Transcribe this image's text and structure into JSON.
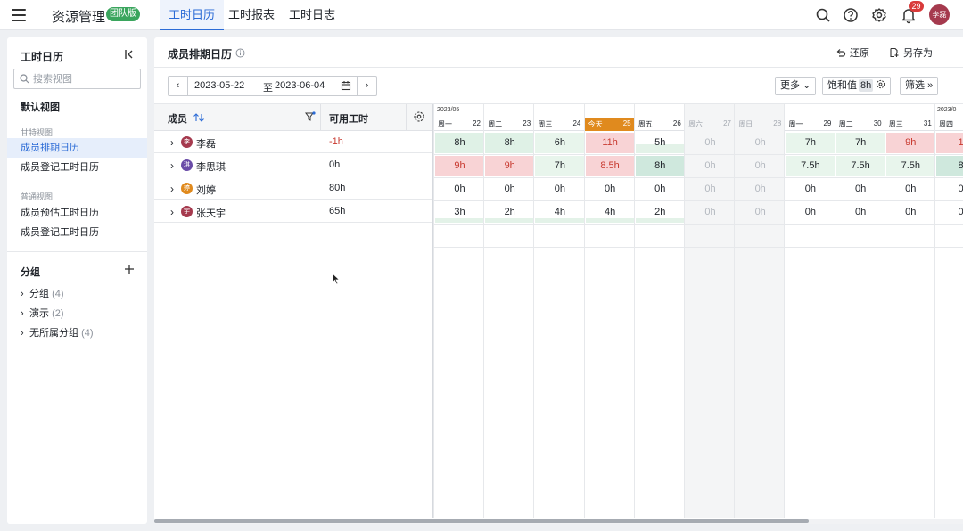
{
  "topbar": {
    "app_title": "资源管理",
    "badge": "团队版",
    "tabs": [
      {
        "label": "工时日历",
        "active": true
      },
      {
        "label": "工时报表",
        "active": false
      },
      {
        "label": "工时日志",
        "active": false
      }
    ],
    "notification_count": "29",
    "user_avatar": "李磊",
    "icons": [
      "menu-icon",
      "search-icon",
      "help-icon",
      "gear-icon",
      "bell-icon"
    ]
  },
  "sidebar": {
    "title": "工时日历",
    "search_placeholder": "搜索视图",
    "default_view": "默认视图",
    "starred_section": "甘特视图",
    "starred_items": [
      "成员排期日历",
      "成员登记工时日历"
    ],
    "normal_section": "普通视图",
    "normal_items": [
      "成员预估工时日历",
      "成员登记工时日历"
    ],
    "group_title": "分组",
    "groups": [
      {
        "label": "分组",
        "count": "(4)"
      },
      {
        "label": "演示",
        "count": "(2)"
      },
      {
        "label": "无所属分组",
        "count": "(4)"
      }
    ]
  },
  "main": {
    "title": "成员排期日历",
    "restore_label": "还原",
    "save_as_label": "另存为",
    "date_start": "2023-05-22",
    "date_sep": "至",
    "date_end": "2023-06-04",
    "more_label": "更多",
    "saturation_label": "饱和值",
    "saturation_value": "8h",
    "filter_label": "筛选"
  },
  "table": {
    "col_member": "成员",
    "col_available": "可用工时",
    "members": [
      {
        "name": "李磊",
        "avatar": "李",
        "avatar_color": "#a53a4e",
        "available": "-1h"
      },
      {
        "name": "李思琪",
        "avatar": "琪",
        "avatar_color": "#6a4ca8",
        "available": "0h"
      },
      {
        "name": "刘婷",
        "avatar": "婷",
        "avatar_color": "#e08a1e",
        "available": "80h"
      },
      {
        "name": "张天宇",
        "avatar": "宇",
        "avatar_color": "#a53a4e",
        "available": "65h"
      }
    ]
  },
  "calendar": {
    "month_labels": [
      "2023/05",
      "2023/0"
    ],
    "days": [
      {
        "wk": "周一",
        "d": "22",
        "type": "work"
      },
      {
        "wk": "周二",
        "d": "23",
        "type": "work"
      },
      {
        "wk": "周三",
        "d": "24",
        "type": "work"
      },
      {
        "wk": "今天",
        "d": "25",
        "type": "today"
      },
      {
        "wk": "周五",
        "d": "26",
        "type": "work"
      },
      {
        "wk": "周六",
        "d": "27",
        "type": "weekend"
      },
      {
        "wk": "周日",
        "d": "28",
        "type": "weekend"
      },
      {
        "wk": "周一",
        "d": "29",
        "type": "work"
      },
      {
        "wk": "周二",
        "d": "30",
        "type": "work"
      },
      {
        "wk": "周三",
        "d": "31",
        "type": "work"
      },
      {
        "wk": "周四",
        "d": "",
        "type": "work"
      }
    ],
    "rows": [
      [
        {
          "v": "8h",
          "s": "green"
        },
        {
          "v": "8h",
          "s": "green"
        },
        {
          "v": "6h",
          "s": "green3"
        },
        {
          "v": "11h",
          "s": "red"
        },
        {
          "v": "5h",
          "s": "bar2"
        },
        {
          "v": "0h",
          "s": "gray"
        },
        {
          "v": "0h",
          "s": "gray"
        },
        {
          "v": "7h",
          "s": "green3"
        },
        {
          "v": "7h",
          "s": "green3"
        },
        {
          "v": "9h",
          "s": "red"
        },
        {
          "v": "1",
          "s": "red"
        }
      ],
      [
        {
          "v": "9h",
          "s": "red"
        },
        {
          "v": "9h",
          "s": "red"
        },
        {
          "v": "7h",
          "s": "green3"
        },
        {
          "v": "8.5h",
          "s": "red"
        },
        {
          "v": "8h",
          "s": "green2"
        },
        {
          "v": "0h",
          "s": "gray"
        },
        {
          "v": "0h",
          "s": "gray"
        },
        {
          "v": "7.5h",
          "s": "green3"
        },
        {
          "v": "7.5h",
          "s": "green3"
        },
        {
          "v": "7.5h",
          "s": "green3"
        },
        {
          "v": "8",
          "s": "green2"
        }
      ],
      [
        {
          "v": "0h",
          "s": ""
        },
        {
          "v": "0h",
          "s": ""
        },
        {
          "v": "0h",
          "s": ""
        },
        {
          "v": "0h",
          "s": ""
        },
        {
          "v": "0h",
          "s": ""
        },
        {
          "v": "0h",
          "s": "gray"
        },
        {
          "v": "0h",
          "s": "gray"
        },
        {
          "v": "0h",
          "s": ""
        },
        {
          "v": "0h",
          "s": ""
        },
        {
          "v": "0h",
          "s": ""
        },
        {
          "v": "0",
          "s": ""
        }
      ],
      [
        {
          "v": "3h",
          "s": "bar"
        },
        {
          "v": "2h",
          "s": "bar"
        },
        {
          "v": "4h",
          "s": "bar"
        },
        {
          "v": "4h",
          "s": "bar"
        },
        {
          "v": "2h",
          "s": "bar"
        },
        {
          "v": "0h",
          "s": "gray"
        },
        {
          "v": "0h",
          "s": "gray"
        },
        {
          "v": "0h",
          "s": ""
        },
        {
          "v": "0h",
          "s": ""
        },
        {
          "v": "0h",
          "s": ""
        },
        {
          "v": "0",
          "s": ""
        }
      ]
    ]
  }
}
